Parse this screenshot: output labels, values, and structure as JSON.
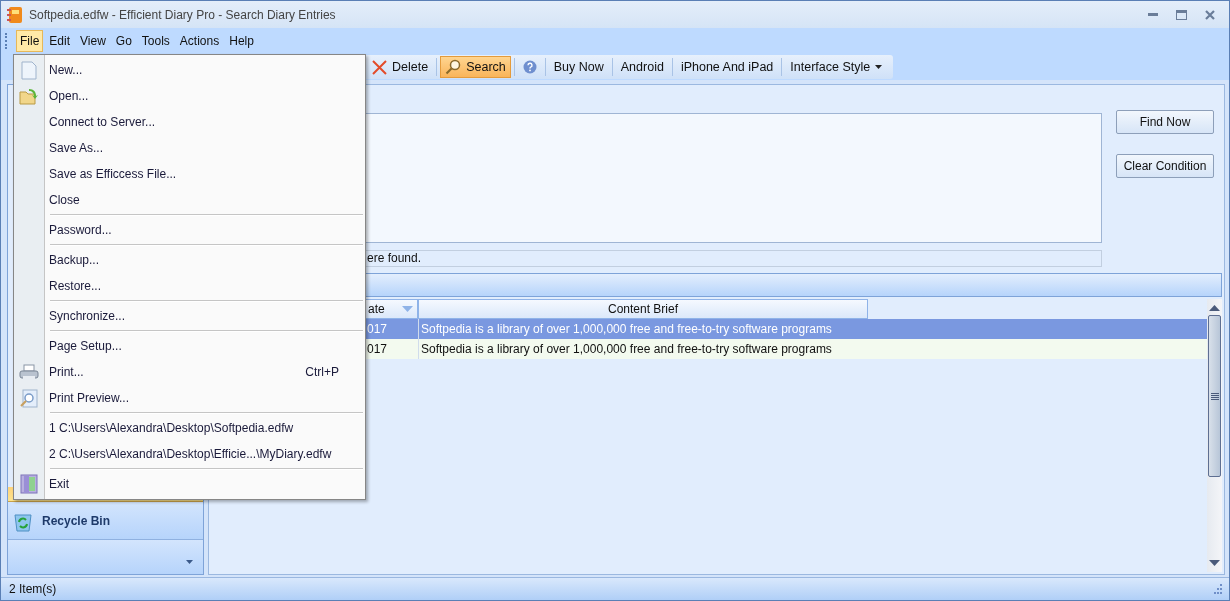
{
  "window": {
    "title": "Softpedia.edfw - Efficient Diary Pro - Search Diary Entries"
  },
  "menubar": [
    {
      "label": "File",
      "selected": true
    },
    {
      "label": "Edit",
      "selected": false
    },
    {
      "label": "View",
      "selected": false
    },
    {
      "label": "Go",
      "selected": false
    },
    {
      "label": "Tools",
      "selected": false
    },
    {
      "label": "Actions",
      "selected": false
    },
    {
      "label": "Help",
      "selected": false
    }
  ],
  "file_menu": [
    {
      "kind": "item",
      "label": "New..."
    },
    {
      "kind": "item",
      "label": "Open..."
    },
    {
      "kind": "item",
      "label": "Connect to Server..."
    },
    {
      "kind": "item",
      "label": "Save As..."
    },
    {
      "kind": "item",
      "label": "Save as Efficcess File..."
    },
    {
      "kind": "item",
      "label": "Close"
    },
    {
      "kind": "separator"
    },
    {
      "kind": "item",
      "label": "Password..."
    },
    {
      "kind": "separator"
    },
    {
      "kind": "item",
      "label": "Backup..."
    },
    {
      "kind": "item",
      "label": "Restore..."
    },
    {
      "kind": "separator"
    },
    {
      "kind": "item",
      "label": "Synchronize..."
    },
    {
      "kind": "separator"
    },
    {
      "kind": "item",
      "label": "Page Setup..."
    },
    {
      "kind": "item",
      "label": "Print...",
      "shortcut": "Ctrl+P"
    },
    {
      "kind": "item",
      "label": "Print Preview..."
    },
    {
      "kind": "separator"
    },
    {
      "kind": "item",
      "label": "1 C:\\Users\\Alexandra\\Desktop\\Softpedia.edfw"
    },
    {
      "kind": "item",
      "label": "2 C:\\Users\\Alexandra\\Desktop\\Efficie...\\MyDiary.edfw"
    },
    {
      "kind": "separator"
    },
    {
      "kind": "item",
      "label": "Exit"
    }
  ],
  "toolbar": [
    {
      "kind": "delete",
      "label": "Delete",
      "selected": false
    },
    {
      "kind": "search",
      "label": "Search",
      "selected": true
    },
    {
      "kind": "help",
      "selected": false
    },
    {
      "kind": "text",
      "label": "Buy Now",
      "selected": false
    },
    {
      "kind": "text",
      "label": "Android",
      "selected": false
    },
    {
      "kind": "text",
      "label": "iPhone And iPad",
      "selected": false
    },
    {
      "kind": "dropdown",
      "label": "Interface Style",
      "selected": false
    }
  ],
  "sidebar": {
    "items": [
      {
        "label": "Recycle Bin",
        "selected": false
      }
    ]
  },
  "search": {
    "find_button": "Find Now",
    "clear_button": "Clear Condition",
    "result_text": "ere found."
  },
  "table": {
    "columns": [
      "ate",
      "Content Brief"
    ],
    "rows": [
      {
        "cells": [
          "017",
          "Softpedia is a library of over 1,000,000 free and free-to-try software programs"
        ],
        "selected": true
      },
      {
        "cells": [
          "017",
          "Softpedia is a library of over 1,000,000 free and free-to-try software programs"
        ],
        "selected": false
      }
    ]
  },
  "status_bar": {
    "text": "2 Item(s)"
  }
}
